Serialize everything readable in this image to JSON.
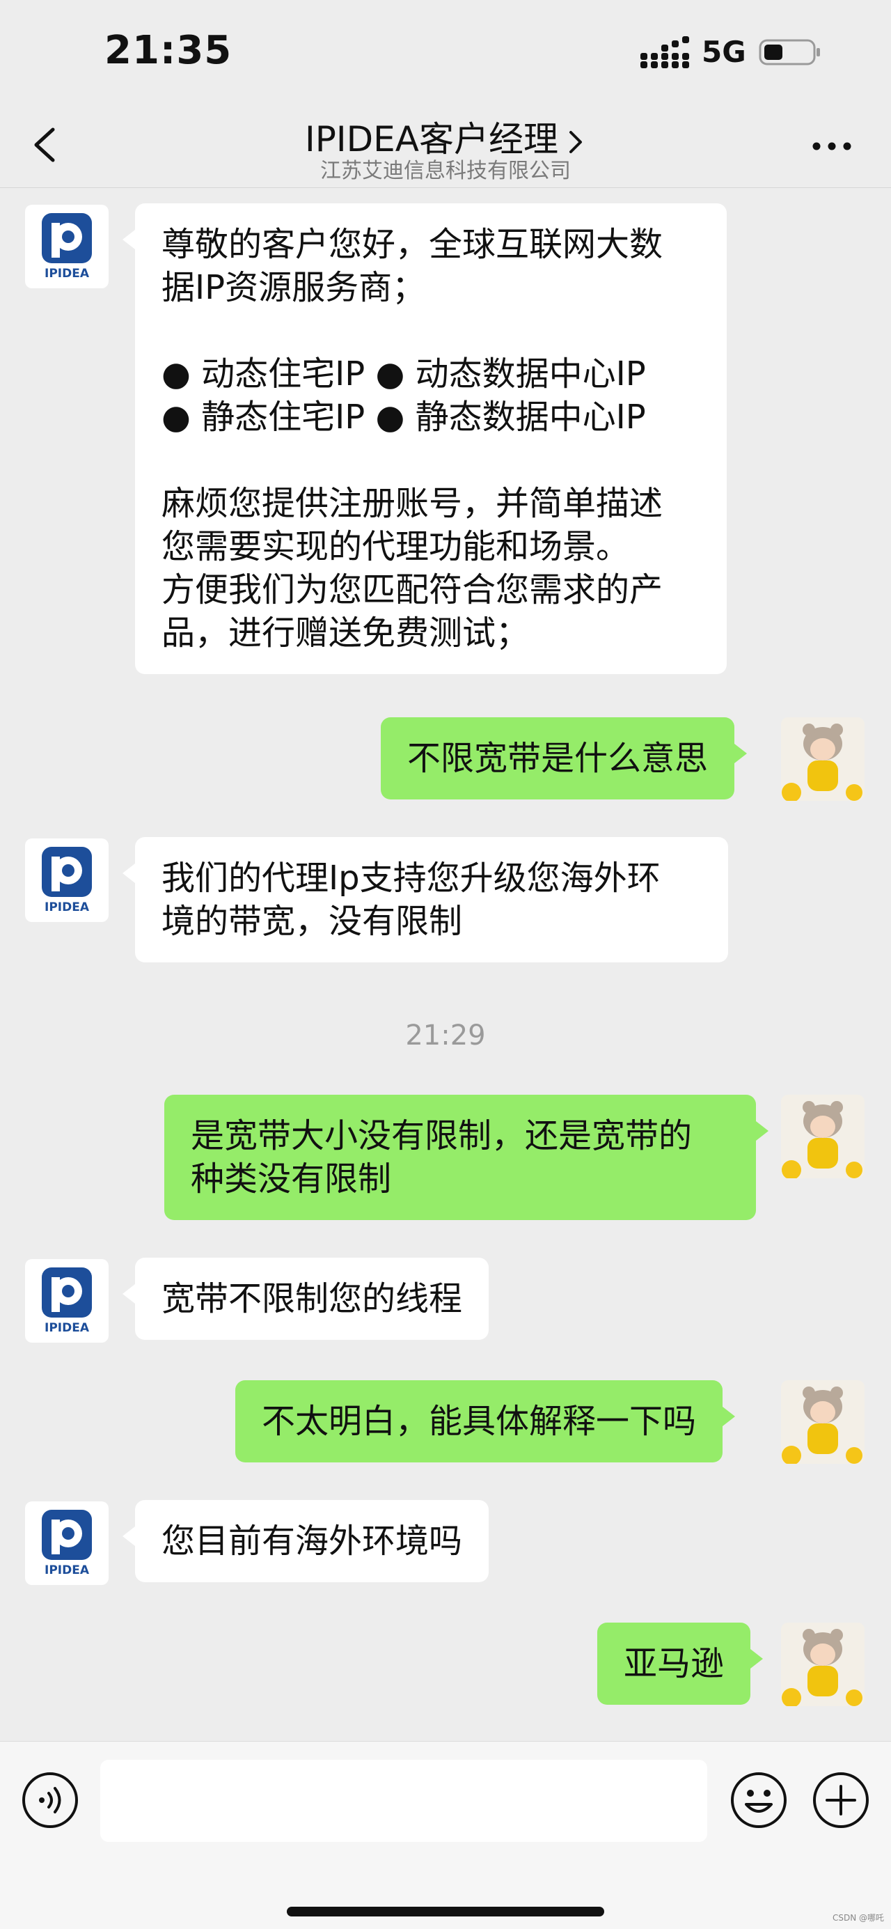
{
  "status": {
    "time": "21:35",
    "network": "5G"
  },
  "nav": {
    "title": "IPIDEA客户经理",
    "subtitle": "江苏艾迪信息科技有限公司"
  },
  "contact": {
    "logo_text": "IPIDEA",
    "logo_color": "#1d4e9a"
  },
  "messages": [
    {
      "from": "contact",
      "text": "尊敬的客户您好，全球互联网大数\n据IP资源服务商；\n\n● 动态住宅IP ● 动态数据中心IP\n● 静态住宅IP ● 静态数据中心IP\n\n麻烦您提供注册账号，并简单描述\n您需要实现的代理功能和场景。\n方便我们为您匹配符合您需求的产\n品，进行赠送免费测试；"
    },
    {
      "from": "me",
      "text": "不限宽带是什么意思"
    },
    {
      "from": "contact",
      "text": "我们的代理Ip支持您升级您海外环\n境的带宽，没有限制"
    },
    {
      "timestamp": "21:29"
    },
    {
      "from": "me",
      "text": "是宽带大小没有限制，还是宽带的\n种类没有限制"
    },
    {
      "from": "contact",
      "text": "宽带不限制您的线程"
    },
    {
      "from": "me",
      "text": "不太明白，能具体解释一下吗"
    },
    {
      "from": "contact",
      "text": "您目前有海外环境吗"
    },
    {
      "from": "me",
      "text": "亚马逊"
    }
  ],
  "input": {
    "value": "",
    "placeholder": ""
  },
  "watermark": "CSDN @哪吒",
  "colors": {
    "bubble_out": "#95ec69",
    "bubble_in": "#ffffff",
    "background": "#ededed"
  }
}
